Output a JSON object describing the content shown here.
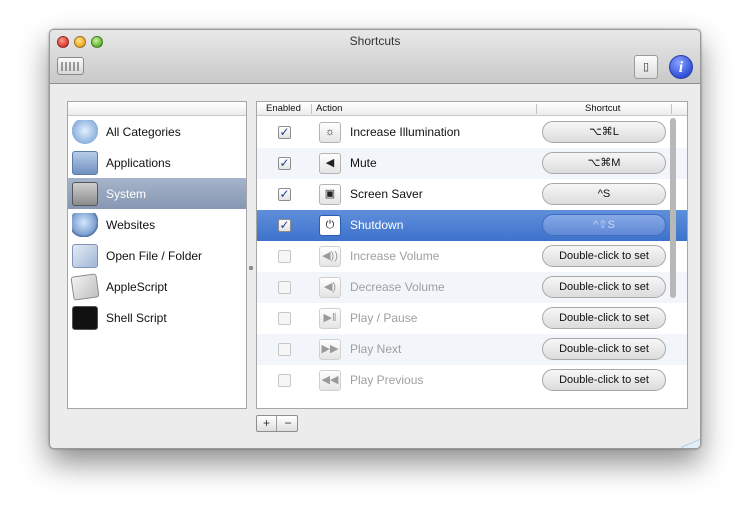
{
  "window": {
    "title": "Shortcuts"
  },
  "toolbar": {
    "usb_label": "▯",
    "info_label": "i"
  },
  "sidebar": {
    "items": [
      {
        "label": "All Categories",
        "icon": "all-categories-icon"
      },
      {
        "label": "Applications",
        "icon": "applications-folder-icon"
      },
      {
        "label": "System",
        "icon": "system-icon",
        "selected": true
      },
      {
        "label": "Websites",
        "icon": "websites-globe-icon"
      },
      {
        "label": "Open File / Folder",
        "icon": "open-file-icon"
      },
      {
        "label": "AppleScript",
        "icon": "applescript-icon"
      },
      {
        "label": "Shell Script",
        "icon": "terminal-icon"
      }
    ]
  },
  "table": {
    "headers": {
      "enabled": "Enabled",
      "action": "Action",
      "shortcut": "Shortcut"
    },
    "rows": [
      {
        "enabled": true,
        "check": "✓",
        "icon_glyph": "☼",
        "icon": "illumination-icon",
        "action": "Increase Illumination",
        "shortcut": "⌥⌘L"
      },
      {
        "enabled": true,
        "check": "✓",
        "icon_glyph": "◀",
        "icon": "mute-speaker-icon",
        "action": "Mute",
        "shortcut": "⌥⌘M"
      },
      {
        "enabled": true,
        "check": "✓",
        "icon_glyph": "▣",
        "icon": "screen-saver-icon",
        "action": "Screen Saver",
        "shortcut": "^S"
      },
      {
        "enabled": true,
        "check": "✓",
        "icon_glyph": "⏻",
        "icon": "power-icon",
        "action": "Shutdown",
        "shortcut": "^⇧S",
        "selected": true
      },
      {
        "enabled": false,
        "check": "",
        "icon_glyph": "◀))",
        "icon": "volume-up-icon",
        "action": "Increase Volume",
        "shortcut": "Double-click to set"
      },
      {
        "enabled": false,
        "check": "",
        "icon_glyph": "◀)",
        "icon": "volume-down-icon",
        "action": "Decrease Volume",
        "shortcut": "Double-click to set"
      },
      {
        "enabled": false,
        "check": "",
        "icon_glyph": "▶‖",
        "icon": "play-pause-icon",
        "action": "Play / Pause",
        "shortcut": "Double-click to set"
      },
      {
        "enabled": false,
        "check": "",
        "icon_glyph": "▶▶",
        "icon": "next-icon",
        "action": "Play Next",
        "shortcut": "Double-click to set"
      },
      {
        "enabled": false,
        "check": "",
        "icon_glyph": "◀◀",
        "icon": "previous-icon",
        "action": "Play Previous",
        "shortcut": "Double-click to set"
      }
    ]
  },
  "footer": {
    "plus": "+",
    "minus": "−"
  }
}
